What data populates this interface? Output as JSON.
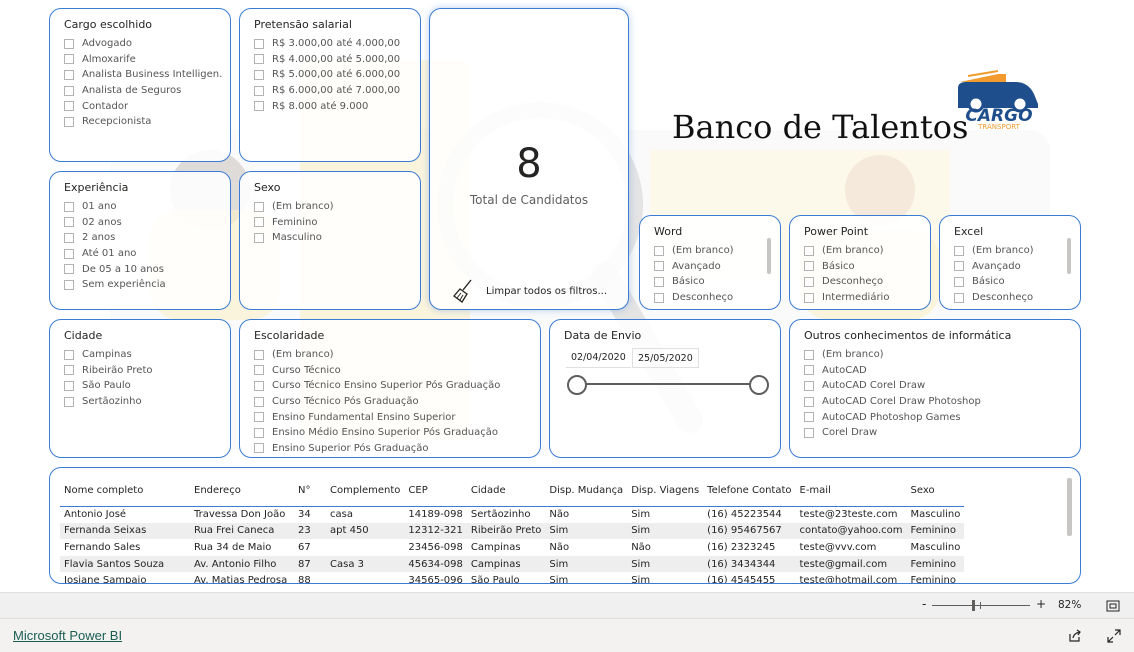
{
  "report": {
    "title": "Banco de Talentos",
    "logo": {
      "main": "CARGO",
      "sub": "TRANSPORT"
    }
  },
  "slicers": {
    "cargo": {
      "title": "Cargo escolhido",
      "items": [
        "Advogado",
        "Almoxarife",
        "Analista Business Intelligen...",
        "Analista de Seguros",
        "Contador",
        "Recepcionista"
      ]
    },
    "pretensao": {
      "title": "Pretensão salarial",
      "items": [
        "R$ 3.000,00 até 4.000,00",
        "R$ 4.000,00 até 5.000,00",
        "R$ 5.000,00 até 6.000,00",
        "R$ 6.000,00 até 7.000,00",
        "R$ 8.000 até 9.000"
      ]
    },
    "experiencia": {
      "title": "Experiência",
      "items": [
        "01 ano",
        "02 anos",
        "2 anos",
        "Até 01 ano",
        "De 05 a 10 anos",
        "Sem experiência"
      ]
    },
    "sexo": {
      "title": "Sexo",
      "items": [
        "(Em branco)",
        "Feminino",
        "Masculino"
      ]
    },
    "word": {
      "title": "Word",
      "items": [
        "(Em branco)",
        "Avançado",
        "Básico",
        "Desconheço"
      ]
    },
    "powerpoint": {
      "title": "Power Point",
      "items": [
        "(Em branco)",
        "Básico",
        "Desconheço",
        "Intermediário"
      ]
    },
    "excel": {
      "title": "Excel",
      "items": [
        "(Em branco)",
        "Avançado",
        "Básico",
        "Desconheço"
      ]
    },
    "cidade": {
      "title": "Cidade",
      "items": [
        "Campinas",
        "Ribeirão Preto",
        "São Paulo",
        "Sertãozinho"
      ]
    },
    "escolaridade": {
      "title": "Escolaridade",
      "items": [
        "(Em branco)",
        "Curso Técnico",
        "Curso Técnico Ensino Superior Pós Graduação",
        "Curso Técnico Pós Graduação",
        "Ensino Fundamental Ensino Superior",
        "Ensino Médio Ensino Superior Pós Graduação",
        "Ensino Superior Pós Graduação"
      ]
    },
    "outros": {
      "title": "Outros conhecimentos de informática",
      "items": [
        "(Em branco)",
        "AutoCAD",
        "AutoCAD Corel Draw",
        "AutoCAD Corel Draw Photoshop",
        "AutoCAD Photoshop Games",
        "Corel Draw"
      ]
    }
  },
  "kpi": {
    "value": "8",
    "label": "Total de Candidatos",
    "clear_label": "Limpar todos os filtros..."
  },
  "date_slicer": {
    "title": "Data de Envio",
    "start": "02/04/2020",
    "end": "25/05/2020"
  },
  "table": {
    "columns": [
      "Nome completo",
      "Endereço",
      "N°",
      "Complemento",
      "CEP",
      "Cidade",
      "Disp. Mudança",
      "Disp. Viagens",
      "Telefone Contato",
      "E-mail",
      "Sexo"
    ],
    "rows": [
      [
        "Antonio José",
        "Travessa Don João",
        "34",
        "casa",
        "14189-098",
        "Sertãozinho",
        "Não",
        "Sim",
        "(16) 45223544",
        "teste@23teste.com",
        "Masculino"
      ],
      [
        "Fernanda Seixas",
        "Rua Frei Caneca",
        "23",
        "apt 450",
        "12312-321",
        "Ribeirão Preto",
        "Sim",
        "Sim",
        "(16) 95467567",
        "contato@yahoo.com",
        "Feminino"
      ],
      [
        "Fernando Sales",
        "Rua 34 de Maio",
        "67",
        "",
        "23456-098",
        "Campinas",
        "Não",
        "Não",
        "(16) 2323245",
        "teste@vvv.com",
        "Masculino"
      ],
      [
        "Flavia Santos Souza",
        "Av. Antonio Filho",
        "87",
        "Casa 3",
        "45634-098",
        "Campinas",
        "Sim",
        "Sim",
        "(16) 3434344",
        "teste@gmail.com",
        "Feminino"
      ],
      [
        "Josiane Sampaio",
        "Av. Matias Pedrosa",
        "88",
        "",
        "34565-096",
        "São Paulo",
        "Sim",
        "Sim",
        "(16) 4545455",
        "teste@hotmail.com",
        "Feminino"
      ]
    ]
  },
  "status": {
    "zoom_minus": "-",
    "zoom_plus": "+",
    "zoom_level": "82%",
    "zoom_fraction": 0.42
  },
  "footer": {
    "brand": "Microsoft Power BI"
  },
  "colors": {
    "card_border": "#3a7bd5",
    "accent_yellow": "#f7d96a",
    "logo_orange": "#f29a2e",
    "logo_blue": "#1f4e8c"
  }
}
